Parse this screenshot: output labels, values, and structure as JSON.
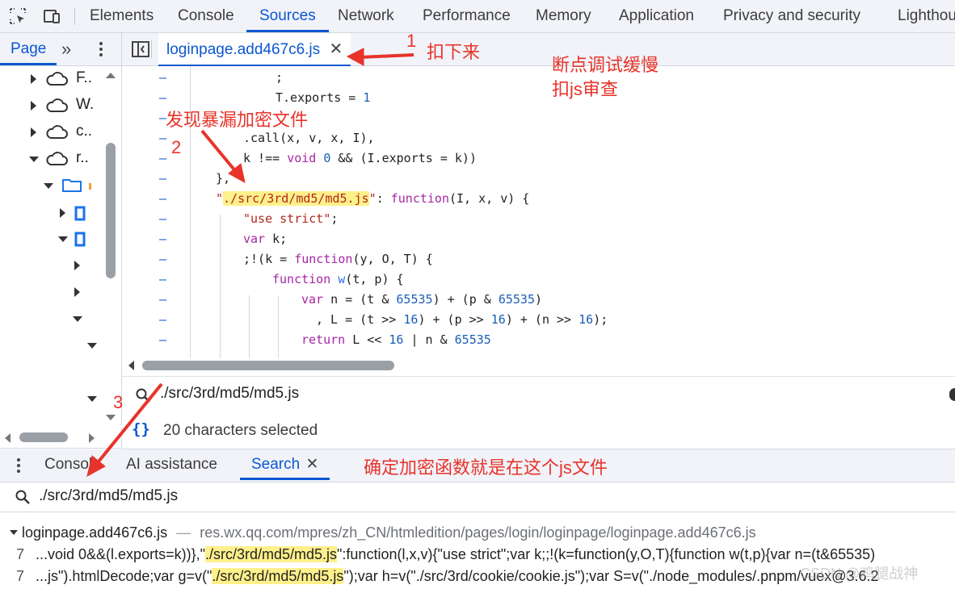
{
  "toolbar": {
    "tabs": [
      "Elements",
      "Console",
      "Sources",
      "Network",
      "Performance",
      "Memory",
      "Application",
      "Privacy and security",
      "Lighthouse"
    ]
  },
  "navigator": {
    "page_tab": "Page",
    "more_tabs": "»",
    "tree": [
      "F..",
      "W.",
      "c..",
      "r.."
    ]
  },
  "editor": {
    "file_tab": "loginpage.add467c6.js",
    "search_query": "./src/3rd/md5/md5.js",
    "status": "20 characters selected",
    "lines": [
      {
        "g": "–",
        "t": ";"
      },
      {
        "g": "–",
        "t": "T.exports = 1"
      },
      {
        "g": "–",
        "t": ""
      },
      {
        "g": "–",
        "t": ".call(x, v, x, I),"
      },
      {
        "g": "–",
        "t": "k !== void 0 && (I.exports = k))"
      },
      {
        "g": "–",
        "t": "},"
      },
      {
        "g": "–",
        "t": "\"./src/3rd/md5/md5.js\": function(I, x, v) {"
      },
      {
        "g": "–",
        "t": "\"use strict\";"
      },
      {
        "g": "–",
        "t": "var k;"
      },
      {
        "g": "–",
        "t": ";!(k = function(y, O, T) {"
      },
      {
        "g": "–",
        "t": "function w(t, p) {"
      },
      {
        "g": "–",
        "t": "var n = (t & 65535) + (p & 65535)"
      },
      {
        "g": "–",
        "t": ", L = (t >> 16) + (p >> 16) + (n >> 16);"
      },
      {
        "g": "–",
        "t": "return L << 16 | n & 65535"
      }
    ]
  },
  "drawer": {
    "tabs": [
      "Console",
      "AI assistance",
      "Search"
    ],
    "search_query": "./src/3rd/md5/md5.js",
    "result_file": "loginpage.add467c6.js",
    "result_url": "res.wx.qq.com/mpres/zh_CN/htmledition/pages/login/loginpage/loginpage.add467c6.js",
    "results": [
      {
        "line": "7",
        "pre": "...void 0&&(l.exports=k))},\"",
        "match": "./src/3rd/md5/md5.js",
        "post": "\":function(l,x,v){\"use strict\";var k;;!(k=function(y,O,T){function w(t,p){var n=(t&65535)"
      },
      {
        "line": "7",
        "pre": "...js\").htmlDecode;var g=v(\"",
        "match": "./src/3rd/md5/md5.js",
        "post": "\");var h=v(\"./src/3rd/cookie/cookie.js\");var S=v(\"./node_modules/.pnpm/vuex@3.6.2"
      }
    ]
  },
  "annotations": {
    "n1": "1",
    "t1": "扣下来",
    "t_top_right": "断点调试缓慢\n扣js审查",
    "t2": "发现暴漏加密文件",
    "n2": "2",
    "n3": "3",
    "t3": "确定加密函数就是在这个js文件",
    "watermark": "CSDN @鸡腿战神"
  }
}
